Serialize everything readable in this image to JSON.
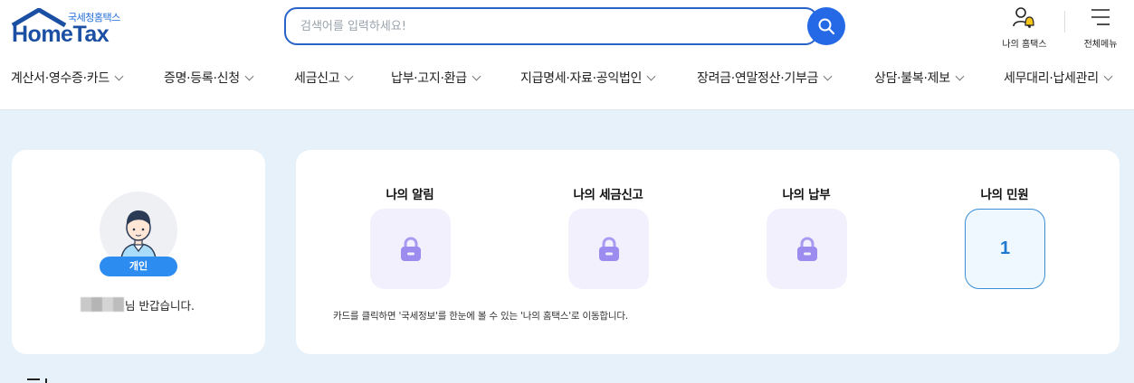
{
  "header": {
    "logo": {
      "sub": "국세청홈택스",
      "main": "HomeTax"
    },
    "search": {
      "placeholder": "검색어를 입력하세요!",
      "button_icon": "search-icon"
    },
    "utils": [
      {
        "label": "나의 홈택스",
        "icon": "user-bell-icon"
      },
      {
        "label": "전체메뉴",
        "icon": "hamburger-menu-icon"
      }
    ],
    "nav": [
      {
        "label": "계산서·영수증·카드"
      },
      {
        "label": "증명·등록·신청"
      },
      {
        "label": "세금신고"
      },
      {
        "label": "납부·고지·환급"
      },
      {
        "label": "지급명세·자료·공익법인"
      },
      {
        "label": "장려금·연말정산·기부금"
      },
      {
        "label": "상담·불복·제보"
      },
      {
        "label": "세무대리·납세관리"
      }
    ]
  },
  "profile": {
    "badge": "개인",
    "greeting_suffix": "님 반갑습니다."
  },
  "summary": {
    "tiles": [
      {
        "title": "나의 알림",
        "locked": true,
        "icon": "lock-icon"
      },
      {
        "title": "나의 세금신고",
        "locked": true,
        "icon": "lock-icon"
      },
      {
        "title": "나의 납부",
        "locked": true,
        "icon": "lock-icon"
      },
      {
        "title": "나의 민원",
        "locked": false,
        "value": "1"
      }
    ],
    "notice": "카드를 클릭하면 '국세정보'를 한눈에 볼 수 있는 '나의 홈택스'로 이동합니다."
  },
  "colors": {
    "brand_blue": "#2569e6",
    "logo_blue": "#1b4fa3",
    "badge_blue": "#2d8cf0",
    "page_bg": "#e6f1fa",
    "lock_tile_bg": "#f2f0fd",
    "lock_color": "#9c8cf0"
  }
}
